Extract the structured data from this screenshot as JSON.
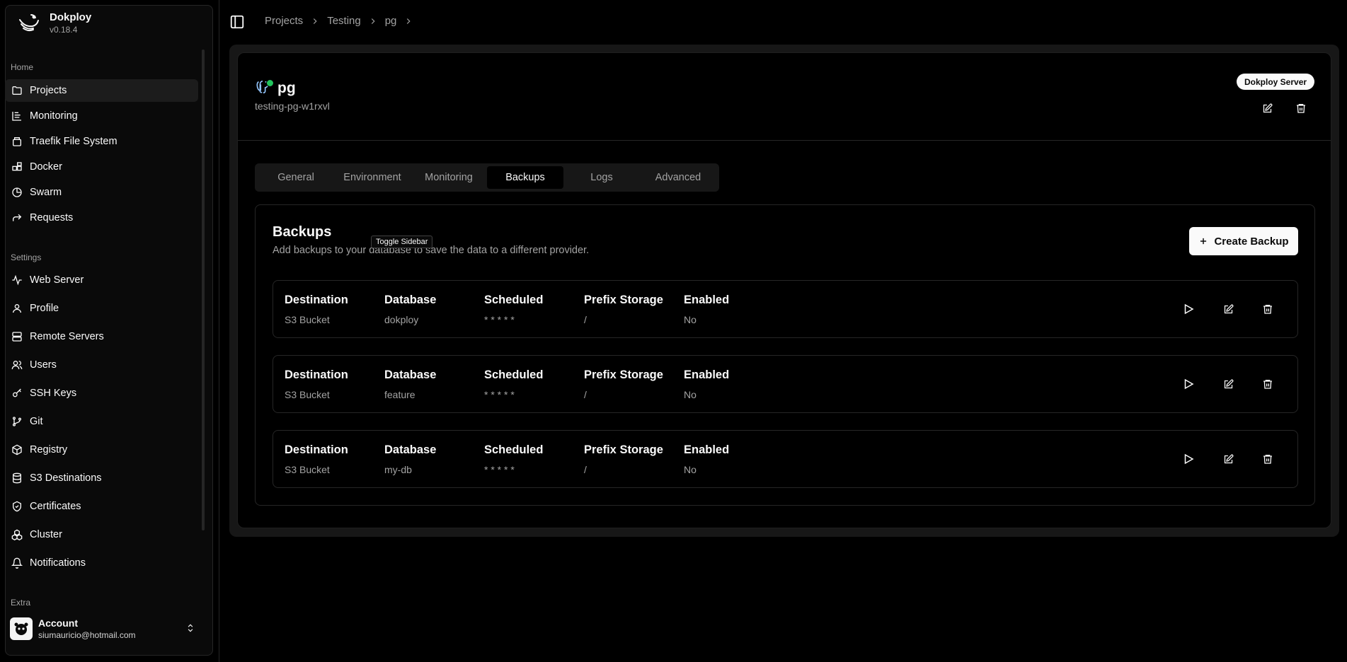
{
  "app": {
    "name": "Dokploy",
    "version": "v0.18.4"
  },
  "sidebar": {
    "groups": {
      "home": "Home",
      "settings": "Settings",
      "extra": "Extra"
    },
    "home_items": [
      {
        "label": "Projects",
        "icon": "folder-icon",
        "active": true
      },
      {
        "label": "Monitoring",
        "icon": "monitoring-icon"
      },
      {
        "label": "Traefik File System",
        "icon": "file-system-icon"
      },
      {
        "label": "Docker",
        "icon": "docker-icon"
      },
      {
        "label": "Swarm",
        "icon": "swarm-icon"
      },
      {
        "label": "Requests",
        "icon": "requests-icon"
      }
    ],
    "settings_items": [
      {
        "label": "Web Server",
        "icon": "activity-icon"
      },
      {
        "label": "Profile",
        "icon": "user-icon"
      },
      {
        "label": "Remote Servers",
        "icon": "server-icon"
      },
      {
        "label": "Users",
        "icon": "users-icon"
      },
      {
        "label": "SSH Keys",
        "icon": "key-icon"
      },
      {
        "label": "Git",
        "icon": "git-branch-icon"
      },
      {
        "label": "Registry",
        "icon": "package-icon"
      },
      {
        "label": "S3 Destinations",
        "icon": "database-icon"
      },
      {
        "label": "Certificates",
        "icon": "shield-check-icon"
      },
      {
        "label": "Cluster",
        "icon": "boxes-icon"
      },
      {
        "label": "Notifications",
        "icon": "bell-icon"
      }
    ],
    "account": {
      "name": "Account",
      "email": "siumauricio@hotmail.com"
    }
  },
  "header": {
    "breadcrumbs": [
      "Projects",
      "Testing",
      "pg"
    ]
  },
  "service": {
    "name": "pg",
    "app_name": "testing-pg-w1rxvl",
    "server_badge": "Dokploy Server",
    "status_color": "#22c55e"
  },
  "tabs": [
    "General",
    "Environment",
    "Monitoring",
    "Backups",
    "Logs",
    "Advanced"
  ],
  "active_tab": "Backups",
  "backups": {
    "title": "Backups",
    "description": "Add backups to your database to save the data to a different provider.",
    "create_label": "Create Backup",
    "tooltip": "Toggle Sidebar",
    "columns": [
      "Destination",
      "Database",
      "Scheduled",
      "Prefix Storage",
      "Enabled"
    ],
    "rows": [
      {
        "destination": "S3 Bucket",
        "database": "dokploy",
        "scheduled": "* * * * *",
        "prefix": "/",
        "enabled": "No"
      },
      {
        "destination": "S3 Bucket",
        "database": "feature",
        "scheduled": "* * * * *",
        "prefix": "/",
        "enabled": "No"
      },
      {
        "destination": "S3 Bucket",
        "database": "my-db",
        "scheduled": "* * * * *",
        "prefix": "/",
        "enabled": "No"
      }
    ]
  }
}
